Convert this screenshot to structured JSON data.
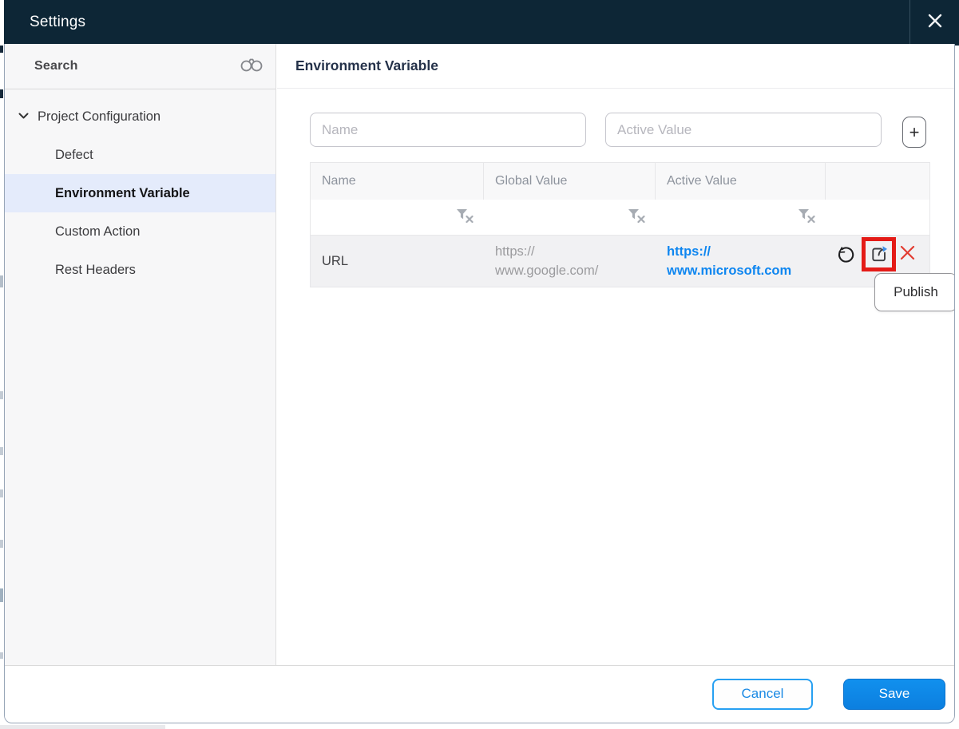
{
  "titlebar": {
    "title": "Settings"
  },
  "sidebar": {
    "search_label": "Search",
    "tree": {
      "parent_label": "Project Configuration",
      "items": [
        {
          "label": "Defect",
          "selected": false
        },
        {
          "label": "Environment Variable",
          "selected": true
        },
        {
          "label": "Custom Action",
          "selected": false
        },
        {
          "label": "Rest Headers",
          "selected": false
        }
      ]
    }
  },
  "main": {
    "heading": "Environment Variable",
    "form": {
      "name_placeholder": "Name",
      "active_value_placeholder": "Active Value",
      "add_button_label": "+"
    },
    "table": {
      "columns": [
        "Name",
        "Global Value",
        "Active Value",
        ""
      ],
      "rows": [
        {
          "name": "URL",
          "global_value": "https://www.google.com/",
          "global_lines": [
            "https://",
            "www.google.com/"
          ],
          "active_value": "https://www.microsoft.com",
          "active_lines": [
            "https://",
            "www.microsoft.com"
          ],
          "actions": [
            "revert",
            "publish",
            "delete"
          ],
          "publish_highlighted": true
        }
      ]
    },
    "tooltip_text": "Publish"
  },
  "footer": {
    "cancel_label": "Cancel",
    "save_label": "Save"
  },
  "colors": {
    "titlebar_bg": "#0d2636",
    "selected_item_bg": "#e4ebfb",
    "link_blue": "#0e86f0",
    "annotation_red": "#e41b17",
    "save_blue": "#0d87e9",
    "cancel_border_blue": "#27a0f2",
    "row_bg": "#f1f1f3"
  }
}
